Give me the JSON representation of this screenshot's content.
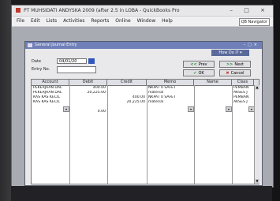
{
  "window": {
    "title": "PT MUHSIDATI ANDYSKA 2009 (after 2.5 in LOBA - QuickBooks Pro",
    "controls": [
      "–",
      "□",
      "×"
    ]
  },
  "menu": {
    "items": [
      "File",
      "Edit",
      "Lists",
      "Activities",
      "Reports",
      "Online",
      "Window",
      "Help"
    ],
    "qb_navigator": "QB Navigator"
  },
  "dialog": {
    "title": "General Journal Entry",
    "how_do_i": "How Do I?",
    "date_label": "Date",
    "date_value": "04/01/20",
    "entry_no_label": "Entry No.",
    "entry_no_value": "",
    "buttons": {
      "prev": "Prev",
      "next": "Next",
      "ok": "OK",
      "cancel": "Cancel"
    },
    "grid": {
      "headers": [
        "Account",
        "Debit",
        "Credit",
        "Memo",
        "Name",
        "Class"
      ],
      "rows": [
        {
          "account": "PEKERJAAN DAL",
          "debit": "400.00",
          "credit": "",
          "memo": "NKPAT 0 SAFET",
          "name": "",
          "class": "PEMBAN"
        },
        {
          "account": "PEKERJAAN DAL",
          "debit": "20,225.00",
          "credit": "",
          "memo": "material",
          "name": "",
          "class": "AKSES J"
        },
        {
          "account": "KAS KAS KECIL",
          "debit": "",
          "credit": "400.00",
          "memo": "NKPAT 0 SAFET",
          "name": "",
          "class": "PEMBAN"
        },
        {
          "account": "KAS KAS KECIL",
          "debit": "",
          "credit": "20,225.00",
          "memo": "material",
          "name": "",
          "class": "AKSES J"
        },
        {
          "account": "",
          "debit": "0.00",
          "credit": "",
          "memo": "",
          "name": "",
          "class": ""
        }
      ]
    }
  }
}
